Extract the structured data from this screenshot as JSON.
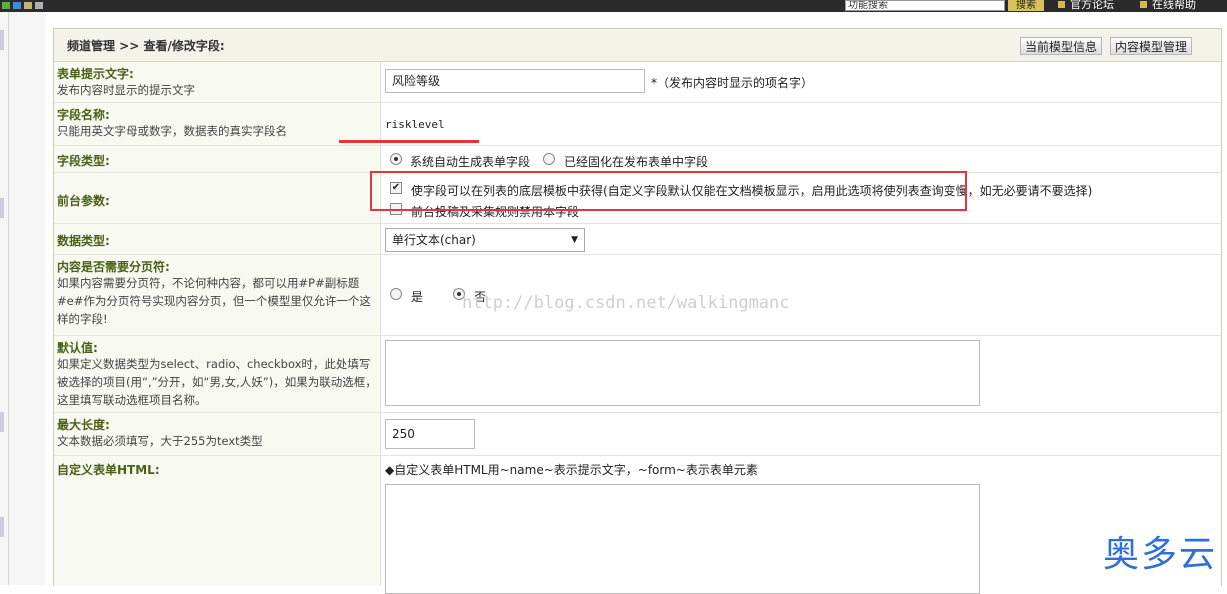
{
  "topbar": {
    "search_value": "功能搜索",
    "search_button": "搜索",
    "links": [
      "官方论坛",
      "在线帮助"
    ]
  },
  "header": {
    "breadcrumb": "频道管理 >> 查看/修改字段:",
    "buttons": [
      "当前模型信息",
      "内容模型管理"
    ]
  },
  "form": {
    "label_text": {
      "title": "表单提示文字:",
      "desc": "发布内容时显示的提示文字",
      "value": "风险等级",
      "note": "*（发布内容时显示的项名字）"
    },
    "field_name": {
      "title": "字段名称:",
      "desc": "只能用英文字母或数字，数据表的真实字段名",
      "value": "risklevel"
    },
    "field_type": {
      "title": "字段类型:",
      "options": [
        "系统自动生成表单字段",
        "已经固化在发布表单中字段"
      ],
      "selected": 0
    },
    "front_params": {
      "title": "前台参数:",
      "option1": "使字段可以在列表的底层模板中获得(自定义字段默认仅能在文档模板显示，启用此选项将使列表查询变慢，如无必要请不要选择)",
      "option1_checked": true,
      "option2": "前台投稿及采集规则禁用本字段",
      "option2_checked": false
    },
    "data_type": {
      "title": "数据类型:",
      "value": "单行文本(char)"
    },
    "paging": {
      "title": "内容是否需要分页符:",
      "desc": "如果内容需要分页符，不论何种内容，都可以用#P#副标题#e#作为分页符号实现内容分页，但一个模型里仅允许一个这样的字段!",
      "options": [
        "是",
        "否"
      ],
      "selected": 1
    },
    "default_value": {
      "title": "默认值:",
      "desc": "如果定义数据类型为select、radio、checkbox时，此处填写被选择的项目(用“,”分开，如“男,女,人妖”)，如果为联动选框，这里填写联动选框项目名称。"
    },
    "max_length": {
      "title": "最大长度:",
      "desc": "文本数据必须填写，大于255为text类型",
      "value": "250"
    },
    "custom_html": {
      "title": "自定义表单HTML:",
      "hint": "◆自定义表单HTML用~name~表示提示文字，~form~表示表单元素"
    }
  },
  "watermark": "http://blog.csdn.net/walkingmanc",
  "brand": "奥多云",
  "colors": {
    "accent_red": "#e5343a",
    "label_green": "#4a6117",
    "brand_blue": "#2f6fd6"
  }
}
